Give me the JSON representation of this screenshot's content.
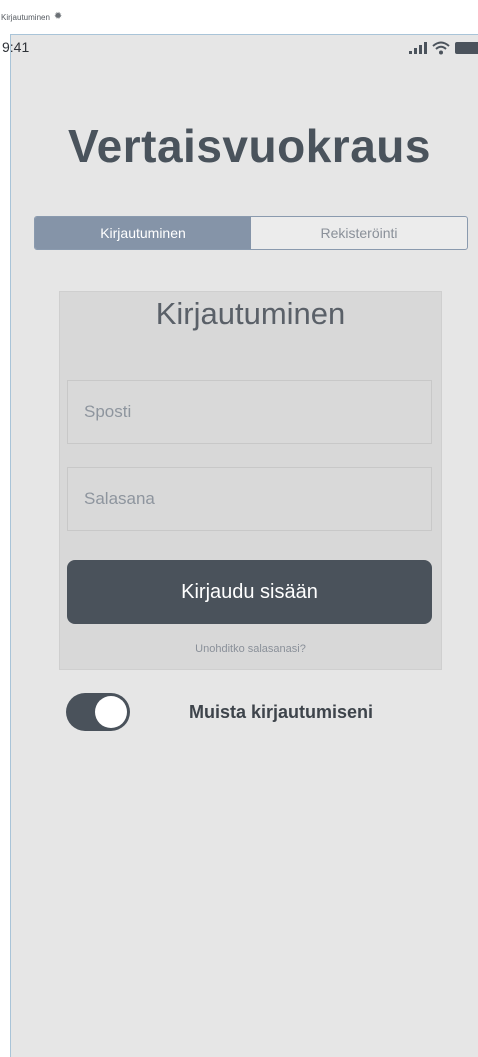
{
  "artboard": {
    "name": "Kirjautuminen",
    "icon": "gear-icon"
  },
  "status_bar": {
    "time": "9:41",
    "icons": [
      "signal-icon",
      "wifi-icon",
      "battery-icon"
    ]
  },
  "app": {
    "title": "Vertaisvuokraus"
  },
  "tabs": [
    {
      "label": "Kirjautuminen",
      "active": true
    },
    {
      "label": "Rekisteröinti",
      "active": false
    }
  ],
  "login_form": {
    "title": "Kirjautuminen",
    "email_placeholder": "Sposti",
    "password_placeholder": "Salasana",
    "submit_label": "Kirjaudu sisään",
    "forgot_label": "Unohditko salasanasi?"
  },
  "remember_me": {
    "label": "Muista kirjautumiseni",
    "enabled": true
  },
  "colors": {
    "background": "#e6e6e6",
    "primary_dark": "#4a525b",
    "tab_active": "#8594a8",
    "card": "#d8d8d8"
  }
}
